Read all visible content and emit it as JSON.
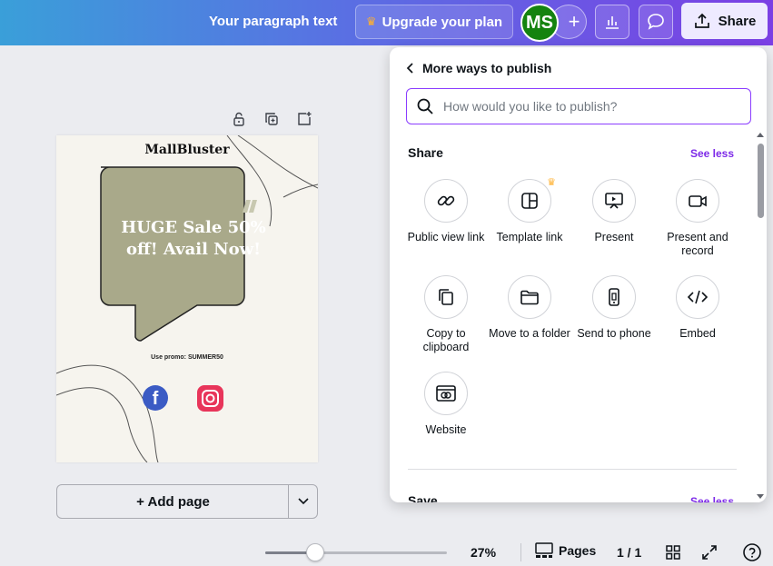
{
  "topbar": {
    "doc_title": "Your paragraph text",
    "upgrade_label": "Upgrade your plan",
    "avatar_initials": "MS",
    "add_collab": "+",
    "share_label": "Share",
    "accent": "#7d2ae8"
  },
  "design": {
    "brand": "MallBluster",
    "headline": "HUGE Sale 50% off! Avail Now!",
    "promo": "Use promo: SUMMER50",
    "bubble_color": "#a9a98a"
  },
  "canvas": {
    "add_page_label": "+ Add page"
  },
  "bottombar": {
    "zoom_value": "27%",
    "zoom_level": 0.27,
    "pages_label": "Pages",
    "page_count": "1 / 1"
  },
  "panel": {
    "title": "More ways to publish",
    "search_placeholder": "How would you like to publish?",
    "share_section": "Share",
    "see_less": "See less",
    "save_section": "Save",
    "options": [
      {
        "label": "Public view link",
        "icon": "link-icon"
      },
      {
        "label": "Template link",
        "icon": "template-icon",
        "premium": true
      },
      {
        "label": "Present",
        "icon": "present-icon"
      },
      {
        "label": "Present and record",
        "icon": "record-icon"
      },
      {
        "label": "Copy to clipboard",
        "icon": "copy-icon"
      },
      {
        "label": "Move to a folder",
        "icon": "folder-icon"
      },
      {
        "label": "Send to phone",
        "icon": "phone-icon"
      },
      {
        "label": "Embed",
        "icon": "embed-icon"
      },
      {
        "label": "Website",
        "icon": "website-icon"
      }
    ]
  }
}
